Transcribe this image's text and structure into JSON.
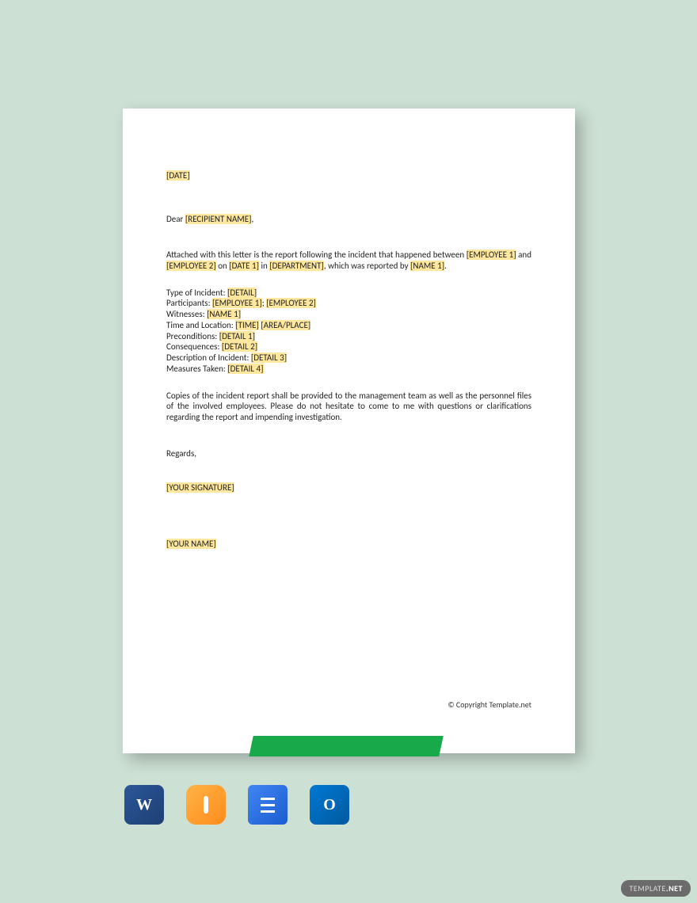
{
  "letter": {
    "date_ph": "[DATE]",
    "dear_prefix": "Dear ",
    "recipient_ph": "[RECIPIENT NAME]",
    "dear_suffix": ",",
    "p1_a": "Attached with this letter is the report following the incident that happened between ",
    "emp1_ph": "[EMPLOYEE 1]",
    "p1_b": " and ",
    "emp2_ph": "[EMPLOYEE 2]",
    "p1_c": " on ",
    "date1_ph": "[DATE 1]",
    "p1_d": " in ",
    "dept_ph": "[DEPARTMENT]",
    "p1_e": ", which was reported by ",
    "name1_ph": "[NAME 1]",
    "p1_f": ".",
    "type_label": "Type of Incident: ",
    "type_ph": "[DETAIL]",
    "part_label": "Participants: ",
    "part_ph1": "[EMPLOYEE 1]",
    "part_sep": "; ",
    "part_ph2": "[EMPLOYEE 2]",
    "wit_label": "Witnesses: ",
    "wit_ph": "[NAME 1]",
    "time_label": "Time and Location: ",
    "time_ph": "[TIME]",
    "time_sep": " ",
    "loc_ph": "[AREA/PLACE]",
    "pre_label": "Preconditions: ",
    "pre_ph": "[DETAIL 1]",
    "con_label": "Consequences: ",
    "con_ph": "[DETAIL 2]",
    "desc_label": "Description of Incident: ",
    "desc_ph": "[DETAIL 3]",
    "meas_label": "Measures Taken: ",
    "meas_ph": "[DETAIL 4]",
    "p2": "Copies of the incident report shall be provided to the management team as well as the personnel files of the involved employees. Please do not hesitate to come to me with questions or clarifications regarding the report and impending investigation.",
    "regards": "Regards,",
    "sig_ph": "[YOUR SIGNATURE]",
    "yourname_ph": "[YOUR NAME]",
    "copyright": "© Copyright Template.net"
  },
  "icons": {
    "word": "W",
    "outlook": "O"
  },
  "badge": {
    "prefix": "TEMPLATE",
    "suffix": ".NET"
  }
}
